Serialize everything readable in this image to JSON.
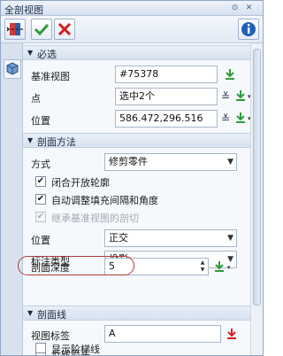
{
  "window": {
    "title": "全剖视图"
  },
  "toolbar": {
    "icons": [
      "section-view-icon",
      "ok-check-icon",
      "cancel-x-icon",
      "info-icon"
    ]
  },
  "sections": {
    "required": {
      "title": "必选",
      "base_view_label": "基准视图",
      "base_view_value": "#75378",
      "point_label": "点",
      "point_value": "选中2个",
      "position_label": "位置",
      "position_value": "586.472,296.516"
    },
    "section_method": {
      "title": "剖面方法",
      "mode_label": "方式",
      "mode_value": "修剪零件",
      "checkboxes": [
        {
          "label": "闭合开放轮廓",
          "checked": true,
          "disabled": false
        },
        {
          "label": "自动调整填充间隔和角度",
          "checked": true,
          "disabled": false
        },
        {
          "label": "继承基准视图的剖切",
          "checked": true,
          "disabled": true
        }
      ],
      "position_label": "位置",
      "position_value": "正交",
      "dim_type_label": "标注类型",
      "dim_type_value": "投影",
      "depth_label": "剖面深度",
      "depth_value": "5"
    },
    "section_line": {
      "title": "剖面线",
      "view_label_label": "视图标签",
      "view_label_value": "A",
      "checkboxes": [
        {
          "label": "反转箭头",
          "checked": false
        },
        {
          "label": "显示阶梯线",
          "checked": false
        }
      ]
    }
  },
  "colors": {
    "accent_green": "#2e9a3a",
    "cancel_red": "#d02020",
    "info_blue": "#1f5fb8",
    "highlight_red": "#b33a3a"
  }
}
